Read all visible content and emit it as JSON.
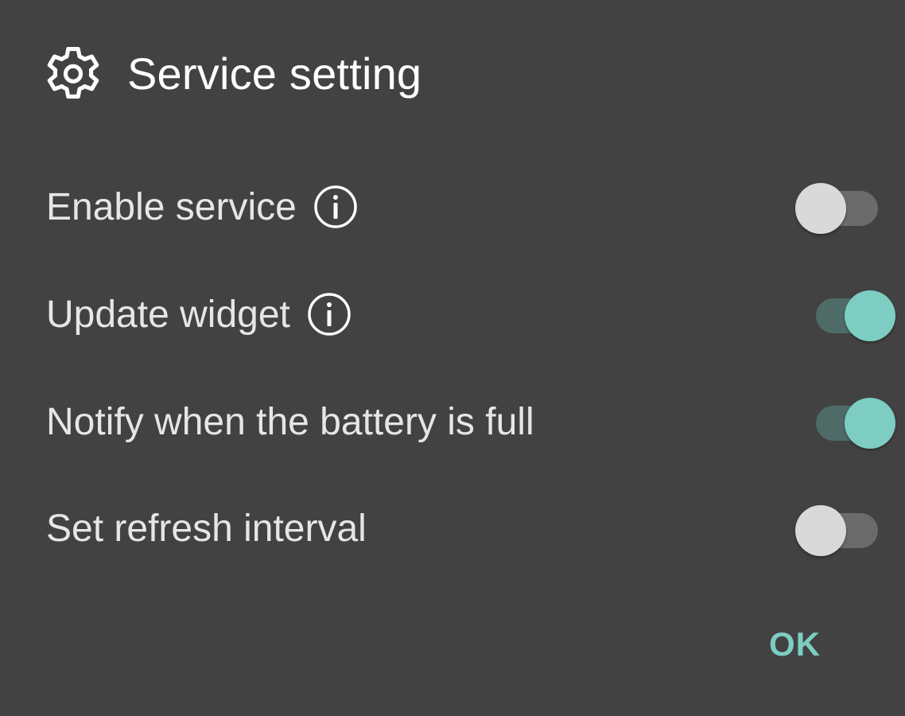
{
  "dialog": {
    "title": "Service setting",
    "title_icon": "gear-icon",
    "accent_color": "#7dcdc3"
  },
  "settings": [
    {
      "label": "Enable service",
      "has_info": true,
      "enabled": false
    },
    {
      "label": "Update widget",
      "has_info": true,
      "enabled": true
    },
    {
      "label": "Notify when the battery is full",
      "has_info": false,
      "enabled": true
    },
    {
      "label": "Set refresh interval",
      "has_info": false,
      "enabled": false
    }
  ],
  "actions": {
    "ok_label": "OK"
  }
}
